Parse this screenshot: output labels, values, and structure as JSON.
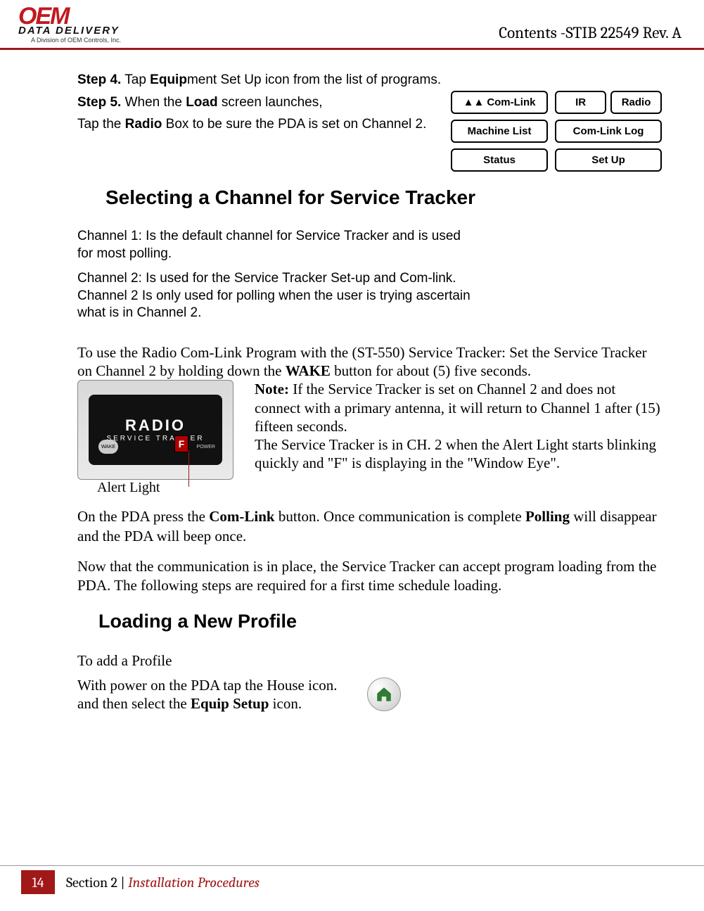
{
  "header": {
    "logo_top": "OEM",
    "logo_mid": "DATA DELIVERY",
    "logo_sub": "A Division of OEM Controls, Inc.",
    "title": "Contents -STIB 22549 Rev. A"
  },
  "steps": {
    "s4_label": "Step 4.",
    "s4_text_a": "  Tap ",
    "s4_bold": "Equip",
    "s4_text_b": "ment Set Up icon from the list of programs.",
    "s5_label": "Step 5.",
    "s5_text": "  When the ",
    "s5_bold": "Load",
    "s5_text_b": " screen launches,",
    "radio_a": "Tap the ",
    "radio_bold": "Radio",
    "radio_b": " Box to be sure the PDA is set on Channel 2."
  },
  "mini_ui": {
    "comlink": "Com-Link",
    "ir": "IR",
    "radio": "Radio",
    "machine": "Machine List",
    "log": "Com-Link Log",
    "status": "Status",
    "setup": "Set Up"
  },
  "h1": "Selecting a Channel for Service Tracker",
  "channels": {
    "c1": "Channel 1: Is the default channel for Service Tracker and is used for most polling.",
    "c2": "Channel  2: Is used for the Service Tracker Set-up and Com-link. Channel 2  Is only used for polling when the user is trying ascertain what is in Channel  2."
  },
  "radio_use": {
    "pre": "To use the Radio Com-Link Program with the (ST-550) Service Tracker: Set the Service Tracker on Channel 2 by holding down the ",
    "bold": "WAKE",
    "post": " button for about (5) five seconds."
  },
  "device": {
    "brand": "RADIO",
    "sub": "SERVICE TRACKER",
    "wake": "WAKE",
    "f": "F",
    "power": "POWER",
    "caption": "Alert Light"
  },
  "note": {
    "label": "Note:",
    "body1": " If the Service Tracker is set on Channel 2 and does not connect with a primary antenna, it will return to Channel 1 after (15) fifteen seconds.",
    "body2": "The Service Tracker is in CH. 2 when the Alert Light starts blinking quickly and \"F\" is displaying in the \"Window Eye\"."
  },
  "comlink_para": {
    "a": "On the PDA press the ",
    "b1": "Com-Link",
    "b": " button. Once communication is complete ",
    "b2": "Polling",
    "c": " will disappear and the PDA will beep once."
  },
  "comm_para": "Now that the communication is in place, the Service Tracker can accept program loading from the PDA. The following steps are required for a first time schedule loading.",
  "h2": "Loading a New Profile",
  "profile": {
    "line1": "To add a Profile",
    "line2a": "With power on the PDA tap the House icon. and then select the ",
    "line2b": "Equip Setup",
    "line2c": " icon."
  },
  "footer": {
    "page": "14",
    "section": "Section 2 | ",
    "italic": "Installation Procedures"
  }
}
